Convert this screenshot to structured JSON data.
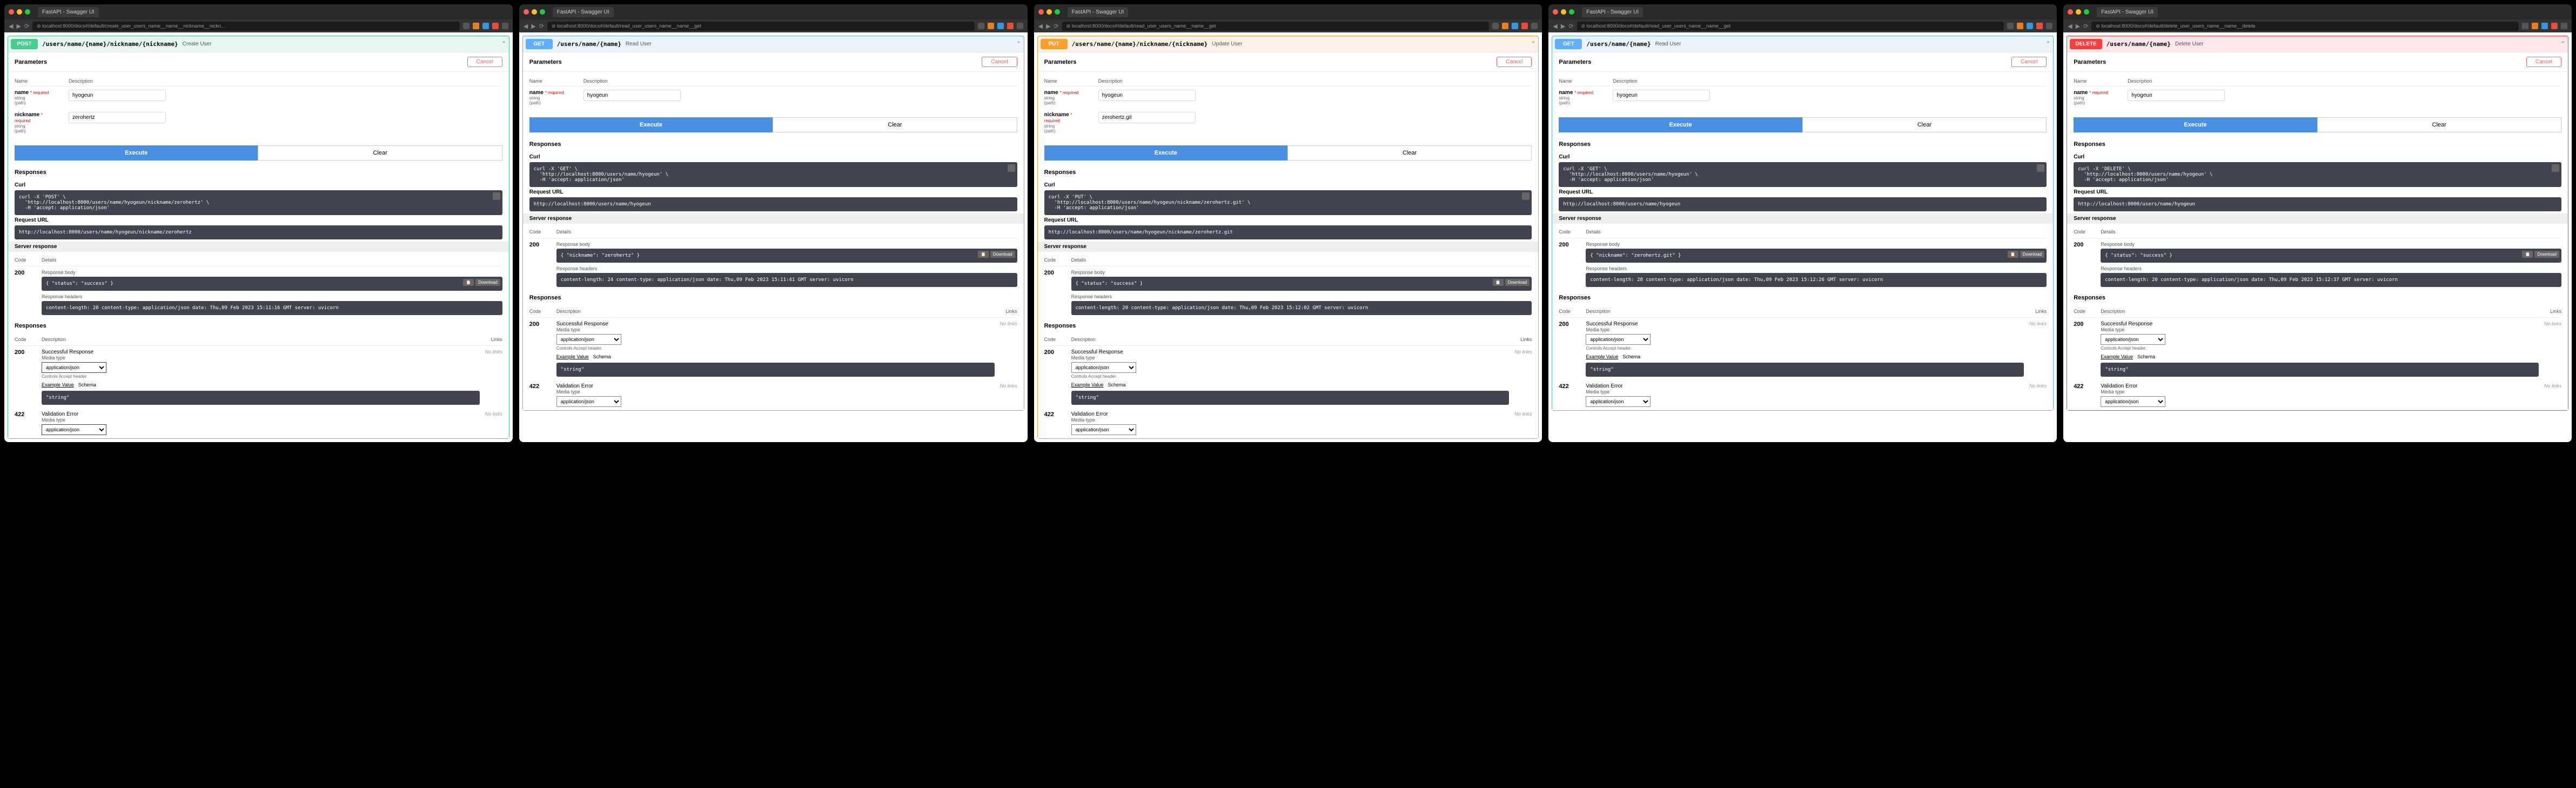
{
  "browser_title": "FastAPI - Swagger UI",
  "panels": [
    {
      "method": "POST",
      "method_class": "post",
      "url": "localhost:8000/docs#/default/create_user_users_name__name__nickname__nickn...",
      "path": "/users/name/{name}/nickname/{nickname}",
      "summary": "Create User",
      "params": [
        {
          "name": "name",
          "req": "* required",
          "type": "string",
          "loc": "(path)",
          "value": "hyogeun"
        },
        {
          "name": "nickname",
          "req": "* required",
          "type": "string",
          "loc": "(path)",
          "value": "zerohertz"
        }
      ],
      "curl": "curl -X 'POST' \\\n  'http://localhost:8000/users/name/hyogeun/nickname/zerohertz' \\\n  -H 'accept: application/json'",
      "request_url": "http://localhost:8000/users/name/hyogeun/nickname/zerohertz",
      "resp_code": "200",
      "resp_body": "{\n  \"status\": \"success\"\n}",
      "resp_headers": " content-length: 20 \n content-type: application/json \n date: Thu,09 Feb 2023 15:11:16 GMT \n server: uvicorn "
    },
    {
      "method": "GET",
      "method_class": "get",
      "url": "localhost:8000/docs#/default/read_user_users_name__name__get",
      "path": "/users/name/{name}",
      "summary": "Read User",
      "params": [
        {
          "name": "name",
          "req": "* required",
          "type": "string",
          "loc": "(path)",
          "value": "hyogeun"
        }
      ],
      "curl": "curl -X 'GET' \\\n  'http://localhost:8000/users/name/hyogeun' \\\n  -H 'accept: application/json'",
      "request_url": "http://localhost:8000/users/name/hyogeun",
      "resp_code": "200",
      "resp_body": "{\n  \"nickname\": \"zerohertz\"\n}",
      "resp_headers": " content-length: 24 \n content-type: application/json \n date: Thu,09 Feb 2023 15:11:41 GMT \n server: uvicorn "
    },
    {
      "method": "PUT",
      "method_class": "put",
      "url": "localhost:8000/docs#/default/read_user_users_name__name__get",
      "path": "/users/name/{name}/nickname/{nickname}",
      "summary": "Update User",
      "params": [
        {
          "name": "name",
          "req": "* required",
          "type": "string",
          "loc": "(path)",
          "value": "hyogeun"
        },
        {
          "name": "nickname",
          "req": "* required",
          "type": "string",
          "loc": "(path)",
          "value": "zerohertz.git"
        }
      ],
      "curl": "curl -X 'PUT' \\\n  'http://localhost:8000/users/name/hyogeun/nickname/zerohertz.git' \\\n  -H 'accept: application/json'",
      "request_url": "http://localhost:8000/users/name/hyogeun/nickname/zerohertz.git",
      "resp_code": "200",
      "resp_body": "{\n  \"status\": \"success\"\n}",
      "resp_headers": " content-length: 20 \n content-type: application/json \n date: Thu,09 Feb 2023 15:12:02 GMT \n server: uvicorn "
    },
    {
      "method": "GET",
      "method_class": "get",
      "url": "localhost:8000/docs#/default/read_user_users_name__name__get",
      "path": "/users/name/{name}",
      "summary": "Read User",
      "params": [
        {
          "name": "name",
          "req": "* required",
          "type": "string",
          "loc": "(path)",
          "value": "hyogeun"
        }
      ],
      "curl": "curl -X 'GET' \\\n  'http://localhost:8000/users/name/hyogeun' \\\n  -H 'accept: application/json'",
      "request_url": "http://localhost:8000/users/name/hyogeun",
      "resp_code": "200",
      "resp_body": "{\n  \"nickname\": \"zerohertz.git\"\n}",
      "resp_headers": " content-length: 28 \n content-type: application/json \n date: Thu,09 Feb 2023 15:12:26 GMT \n server: uvicorn "
    },
    {
      "method": "DELETE",
      "method_class": "delete",
      "url": "localhost:8000/docs#/default/delete_user_users_name__name__delete",
      "path": "/users/name/{name}",
      "summary": "Delete User",
      "params": [
        {
          "name": "name",
          "req": "* required",
          "type": "string",
          "loc": "(path)",
          "value": "hyogeun"
        }
      ],
      "curl": "curl -X 'DELETE' \\\n  'http://localhost:8000/users/name/hyogeun' \\\n  -H 'accept: application/json'",
      "request_url": "http://localhost:8000/users/name/hyogeun",
      "resp_code": "200",
      "resp_body": "{\n  \"status\": \"success\"\n}",
      "resp_headers": " content-length: 20 \n content-type: application/json \n date: Thu,09 Feb 2023 15:12:37 GMT \n server: uvicorn "
    }
  ],
  "labels": {
    "parameters": "Parameters",
    "cancel": "Cancel",
    "name_col": "Name",
    "desc_col": "Description",
    "execute": "Execute",
    "clear": "Clear",
    "responses": "Responses",
    "curl": "Curl",
    "request_url": "Request URL",
    "server_response": "Server response",
    "code": "Code",
    "details": "Details",
    "links": "Links",
    "response_body": "Response body",
    "response_headers": "Response headers",
    "download": "Download",
    "successful": "Successful Response",
    "validation": "Validation Error",
    "media_type": "Media type",
    "media_value": "application/json",
    "media_note": "Controls Accept header.",
    "example_value": "Example Value",
    "schema": "Schema",
    "example_body": "\"string\"",
    "no_links": "No links",
    "code_422": "422",
    "code_200": "200"
  }
}
